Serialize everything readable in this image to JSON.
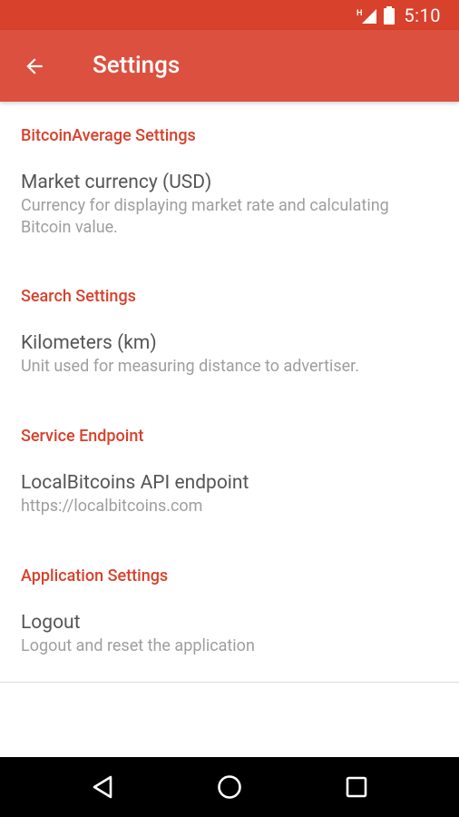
{
  "status_bar": {
    "time": "5:10",
    "icons": [
      "signal-h-icon",
      "battery-icon"
    ]
  },
  "app_bar": {
    "title": "Settings",
    "back_icon": "arrow-back-icon"
  },
  "sections": [
    {
      "header": "BitcoinAverage Settings",
      "items": [
        {
          "title": "Market currency (USD)",
          "summary": "Currency for displaying market rate and calculating Bitcoin value."
        }
      ]
    },
    {
      "header": "Search Settings",
      "items": [
        {
          "title": "Kilometers (km)",
          "summary": "Unit used for measuring distance to advertiser."
        }
      ]
    },
    {
      "header": "Service Endpoint",
      "items": [
        {
          "title": "LocalBitcoins API endpoint",
          "summary": "https://localbitcoins.com"
        }
      ]
    },
    {
      "header": "Application Settings",
      "items": [
        {
          "title": "Logout",
          "summary": "Logout and reset the application"
        }
      ]
    }
  ],
  "nav_bar": {
    "buttons": [
      "back-triangle-icon",
      "home-circle-icon",
      "recents-square-icon"
    ]
  },
  "colors": {
    "status_bar": "#d8412c",
    "app_bar": "#dc5040",
    "accent": "#d8412c"
  }
}
